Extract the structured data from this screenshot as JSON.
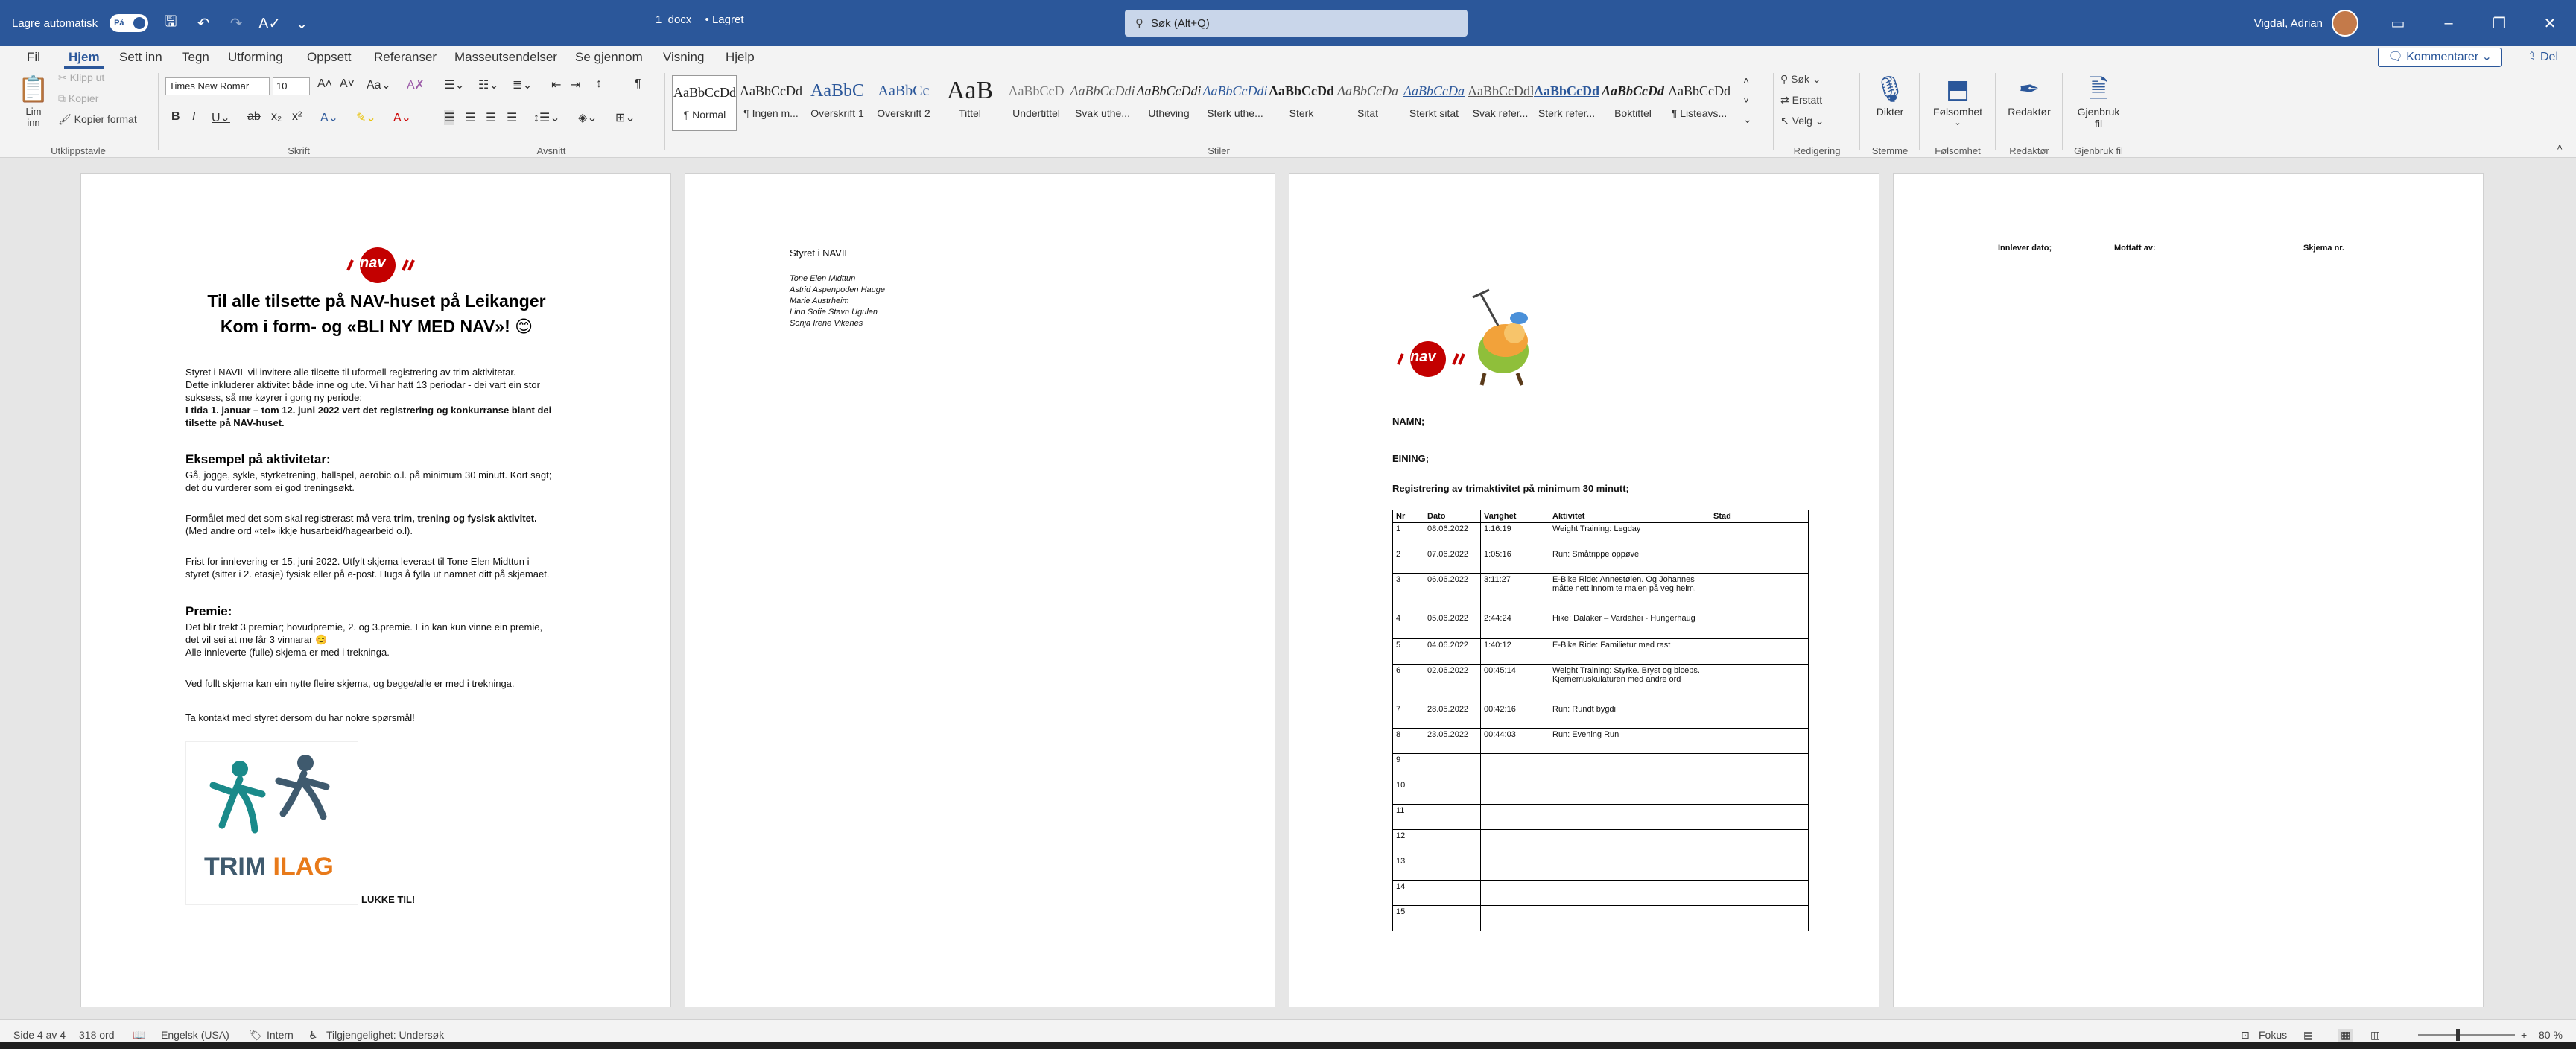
{
  "titlebar": {
    "autosave_label": "Lagre automatisk",
    "autosave_state": "På",
    "doc_title": "1_docx",
    "saved_status": "• Lagret",
    "search_placeholder": "Søk (Alt+Q)",
    "user_name": "Vigdal, Adrian"
  },
  "tabs": [
    "Fil",
    "Hjem",
    "Sett inn",
    "Tegn",
    "Utforming",
    "Oppsett",
    "Referanser",
    "Masseutsendelser",
    "Se gjennom",
    "Visning",
    "Hjelp"
  ],
  "active_tab": "Hjem",
  "toolbar_right": {
    "comments": "Kommentarer",
    "share": "Del"
  },
  "ribbon": {
    "clipboard": {
      "paste": "Lim inn",
      "cut": "Klipp ut",
      "copy": "Kopier",
      "format_painter": "Kopier format",
      "label": "Utklippstavle"
    },
    "font": {
      "family": "Times New Romar",
      "size": "10",
      "label": "Skrift"
    },
    "paragraph": {
      "label": "Avsnitt"
    },
    "styles": {
      "items": [
        {
          "sample": "AaBbCcDd",
          "name": "¶ Normal"
        },
        {
          "sample": "AaBbCcDd",
          "name": "¶ Ingen m..."
        },
        {
          "sample": "AaBbC",
          "name": "Overskrift 1"
        },
        {
          "sample": "AaBbCc",
          "name": "Overskrift 2"
        },
        {
          "sample": "AaB",
          "name": "Tittel"
        },
        {
          "sample": "AaBbCcD",
          "name": "Undertittel"
        },
        {
          "sample": "AaBbCcDdi",
          "name": "Svak uthe..."
        },
        {
          "sample": "AaBbCcDdi",
          "name": "Utheving"
        },
        {
          "sample": "AaBbCcDdi",
          "name": "Sterk uthe..."
        },
        {
          "sample": "AaBbCcDd",
          "name": "Sterk"
        },
        {
          "sample": "AaBbCcDa",
          "name": "Sitat"
        },
        {
          "sample": "AaBbCcDa",
          "name": "Sterkt sitat"
        },
        {
          "sample": "AaBbCcDdE",
          "name": "Svak refer..."
        },
        {
          "sample": "AaBbCcDdE",
          "name": "Sterk refer..."
        },
        {
          "sample": "AaBbCcDd",
          "name": "Boktittel"
        },
        {
          "sample": "AaBbCcDd",
          "name": "¶ Listeavs..."
        }
      ],
      "label": "Stiler"
    },
    "editing": {
      "find": "Søk",
      "replace": "Erstatt",
      "select": "Velg",
      "label": "Redigering"
    },
    "voice": {
      "dictate": "Dikter",
      "label": "Stemme"
    },
    "sensitivity": {
      "btn": "Følsomhet",
      "label": "Følsomhet"
    },
    "editor": {
      "btn": "Redaktør",
      "label": "Redaktør"
    },
    "reuse": {
      "btn1": "Gjenbruk",
      "btn2": "fil",
      "label": "Gjenbruk fil"
    }
  },
  "page1": {
    "logo_text": "nav",
    "title1": "Til alle tilsette på NAV-huset på Leikanger",
    "title2": "Kom i form- og «BLI NY MED NAV»! 😊",
    "intro_lines": [
      "Styret i NAVIL vil invitere alle tilsette til uformell registrering av trim-aktivitetar.",
      "Dette inkluderer aktivitet både inne og ute. Vi har hatt 13 periodar -  dei vart ein stor",
      "suksess, så me køyrer i gong ny periode;"
    ],
    "intro_bold_lines": [
      "I tida 1. januar – tom 12. juni 2022 vert det registrering og konkurranse blant dei",
      "tilsette på NAV-huset."
    ],
    "examples_heading": "Eksempel på aktivitetar:",
    "examples_lines": [
      "Gå, jogge, sykle, styrketrening, ballspel, aerobic o.l. på minimum 30 minutt. Kort sagt;",
      "det du vurderer som ei god treningsøkt."
    ],
    "purpose_prefix": "Formålet med det som skal registrerast må vera ",
    "purpose_bold": "trim, trening og fysisk aktivitet.",
    "purpose_line2": "(Med andre ord «tel» ikkje husarbeid/hagearbeid o.l).",
    "deadline_lines": [
      "Frist for innlevering er 15. juni 2022. Utfylt skjema leverast til Tone Elen Midttun i",
      "styret (sitter i 2. etasje) fysisk eller på e-post. Hugs å fylla ut namnet ditt på skjemaet."
    ],
    "prizes_heading": "Premie:",
    "prizes_lines": [
      "Det blir trekt 3 premiar; hovudpremie, 2. og 3.premie. Ein kan kun vinne ein premie,",
      "det vil sei at me får 3 vinnarar 😊",
      "Alle innleverte (fulle) skjema  er med i trekninga."
    ],
    "more_forms": "Ved fullt skjema kan ein nytte fleire skjema, og begge/alle er med i trekninga.",
    "contact": "Ta kontakt med styret dersom du har nokre spørsmål!",
    "trim_logo_a": "TRIM ",
    "trim_logo_b": "ILAG",
    "good_luck": "LUKKE TIL!"
  },
  "page2": {
    "heading": "Styret i NAVIL",
    "members": [
      "Tone Elen Midttun",
      "Astrid Aspenpoden Hauge",
      "Marie Austrheim",
      "Linn Sofie Stavn Ugulen",
      "Sonja Irene Vikenes"
    ]
  },
  "page3": {
    "logo_text": "nav",
    "name_label": "NAMN;",
    "unit_label": "EINING;",
    "reg_title": "Registrering av trimaktivitet på minimum 30 minutt;",
    "table_headers": [
      "Nr",
      "Dato",
      "Varighet",
      "Aktivitet",
      "Stad"
    ],
    "rows": [
      {
        "nr": "1",
        "date": "08.06.2022",
        "dur": "1:16:19",
        "act": "Weight Training: Legday",
        "place": ""
      },
      {
        "nr": "2",
        "date": "07.06.2022",
        "dur": "1:05:16",
        "act": "Run: Småtrippe oppøve",
        "place": ""
      },
      {
        "nr": "3",
        "date": "06.06.2022",
        "dur": "3:11:27",
        "act": "E-Bike Ride: Annestølen. Og Johannes måtte nett innom te ma'en på veg heim.",
        "place": ""
      },
      {
        "nr": "4",
        "date": "05.06.2022",
        "dur": "2:44:24",
        "act": "Hike: Dalaker – Vardahei - Hungerhaug",
        "place": ""
      },
      {
        "nr": "5",
        "date": "04.06.2022",
        "dur": "1:40:12",
        "act": "E-Bike Ride: Familietur med rast",
        "place": ""
      },
      {
        "nr": "6",
        "date": "02.06.2022",
        "dur": "00:45:14",
        "act": "Weight Training: Styrke. Bryst og biceps. Kjernemuskulaturen med andre ord",
        "place": ""
      },
      {
        "nr": "7",
        "date": "28.05.2022",
        "dur": "00:42:16",
        "act": "Run: Rundt bygdi",
        "place": ""
      },
      {
        "nr": "8",
        "date": "23.05.2022",
        "dur": "00:44:03",
        "act": "Run: Evening Run",
        "place": ""
      },
      {
        "nr": "9",
        "date": "",
        "dur": "",
        "act": "",
        "place": ""
      },
      {
        "nr": "10",
        "date": "",
        "dur": "",
        "act": "",
        "place": ""
      },
      {
        "nr": "11",
        "date": "",
        "dur": "",
        "act": "",
        "place": ""
      },
      {
        "nr": "12",
        "date": "",
        "dur": "",
        "act": "",
        "place": ""
      },
      {
        "nr": "13",
        "date": "",
        "dur": "",
        "act": "",
        "place": ""
      },
      {
        "nr": "14",
        "date": "",
        "dur": "",
        "act": "",
        "place": ""
      },
      {
        "nr": "15",
        "date": "",
        "dur": "",
        "act": "",
        "place": ""
      }
    ]
  },
  "page4": {
    "submitted": "Innlever dato;",
    "received": "Mottatt av:",
    "form_no": "Skjema nr."
  },
  "statusbar": {
    "page": "Side 4 av 4",
    "words": "318 ord",
    "language": "Engelsk (USA)",
    "classification": "Intern",
    "accessibility": "Tilgjengelighet: Undersøk",
    "focus": "Fokus",
    "zoom": "80 %"
  },
  "colors": {
    "word_blue": "#2b579a",
    "nav_red": "#c30000"
  }
}
